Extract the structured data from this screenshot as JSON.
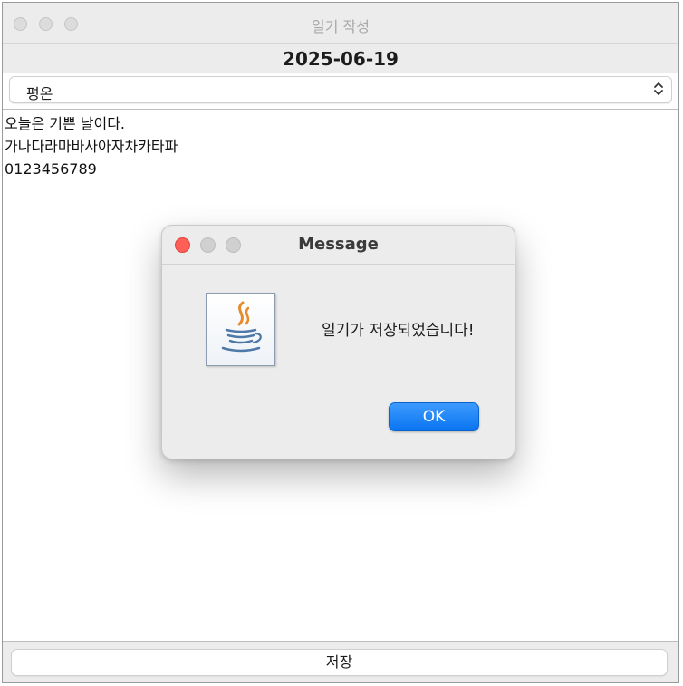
{
  "window": {
    "title": "일기 작성"
  },
  "header": {
    "date": "2025-06-19"
  },
  "mood_select": {
    "selected": "평온"
  },
  "editor": {
    "lines": [
      "오늘은 기쁜 날이다.",
      "가나다라마바사아자차카타파",
      "0123456789"
    ]
  },
  "footer": {
    "save_label": "저장"
  },
  "dialog": {
    "title": "Message",
    "message": "일기가 저장되었습니다!",
    "ok_label": "OK",
    "icon": "java-coffee-cup-icon"
  },
  "colors": {
    "close_red": "#fe5f57",
    "inactive_dot": "#d0d0d0",
    "ok_blue": "#0a74f0"
  }
}
